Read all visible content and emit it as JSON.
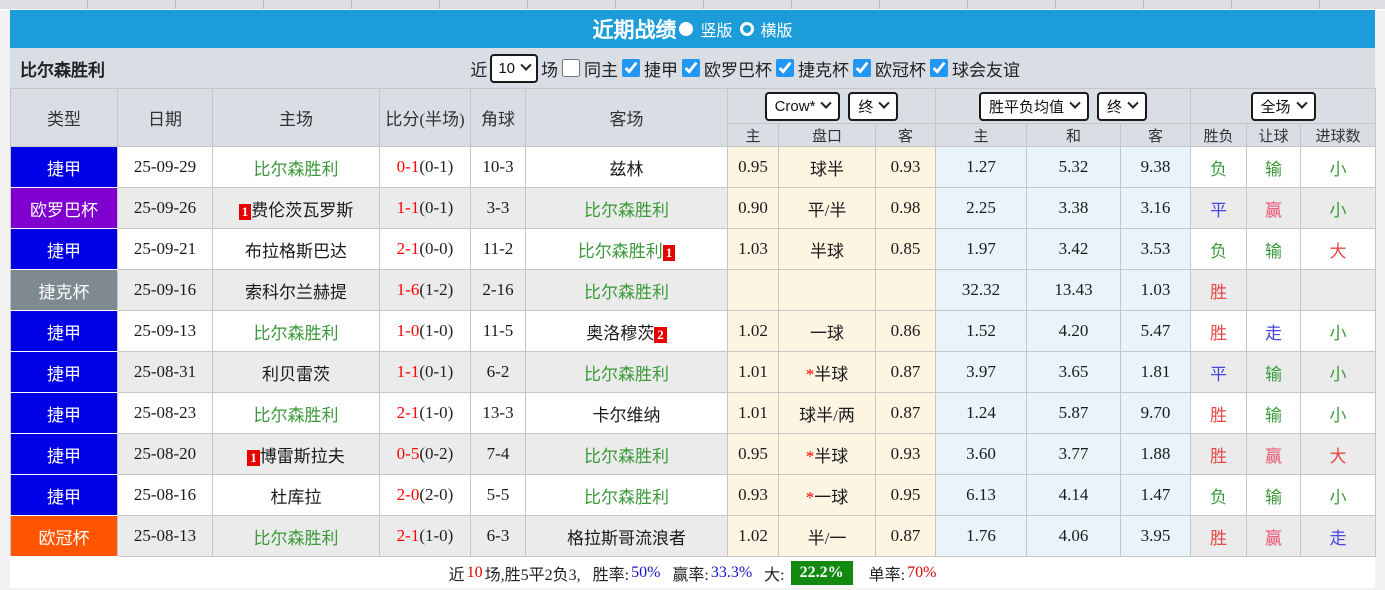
{
  "titlebar": {
    "title": "近期战绩",
    "vertical_label": "竖版",
    "horizontal_label": "横版"
  },
  "filters": {
    "team_name": "比尔森胜利",
    "recent_label": "近",
    "recent_count": "10",
    "matches_label": "场",
    "same_home_label": "同主",
    "league_checkboxes": [
      "捷甲",
      "欧罗巴杯",
      "捷克杯",
      "欧冠杯",
      "球会友谊"
    ]
  },
  "table": {
    "headers": {
      "type": "类型",
      "date": "日期",
      "home": "主场",
      "score": "比分(半场)",
      "corner": "角球",
      "away": "客场",
      "company_select": "Crow*",
      "company_time_select": "终",
      "avg_select": "胜平负均值",
      "avg_time_select": "终",
      "scope_select": "全场",
      "hcp_home": "主",
      "hcp_line": "盘口",
      "hcp_away": "客",
      "odds_home": "主",
      "odds_draw": "和",
      "odds_away": "客",
      "res_wdl": "胜负",
      "res_hcp": "让球",
      "res_goal": "进球数"
    },
    "rows": [
      {
        "type": "捷甲",
        "type_color": "#0000e6",
        "date": "25-09-29",
        "home": {
          "badge_before": "",
          "text": "比尔森胜利",
          "badge_after": "",
          "cls": "green"
        },
        "score_ft": "0-1",
        "score_ht": "(0-1)",
        "corner": "10-3",
        "away": {
          "badge_before": "",
          "text": "兹林",
          "badge_after": "",
          "cls": "plain"
        },
        "hcp": {
          "home": "0.95",
          "line_star": "",
          "line": "球半",
          "away": "0.93"
        },
        "odds": {
          "home": "1.27",
          "draw": "5.32",
          "away": "9.38"
        },
        "results": [
          {
            "text": "负",
            "cls": "green"
          },
          {
            "text": "输",
            "cls": "green"
          },
          {
            "text": "小",
            "cls": "green"
          }
        ]
      },
      {
        "type": "欧罗巴杯",
        "type_color": "#8000d0",
        "date": "25-09-26",
        "home": {
          "badge_before": "1",
          "text": "费伦茨瓦罗斯",
          "badge_after": "",
          "cls": "plain"
        },
        "score_ft": "1-1",
        "score_ht": "(0-1)",
        "corner": "3-3",
        "away": {
          "badge_before": "",
          "text": "比尔森胜利",
          "badge_after": "",
          "cls": "green"
        },
        "hcp": {
          "home": "0.90",
          "line_star": "",
          "line": "平/半",
          "away": "0.98"
        },
        "odds": {
          "home": "2.25",
          "draw": "3.38",
          "away": "3.16"
        },
        "results": [
          {
            "text": "平",
            "cls": "blue"
          },
          {
            "text": "赢",
            "cls": "pink"
          },
          {
            "text": "小",
            "cls": "green"
          }
        ]
      },
      {
        "type": "捷甲",
        "type_color": "#0000e6",
        "date": "25-09-21",
        "home": {
          "badge_before": "",
          "text": "布拉格斯巴达",
          "badge_after": "",
          "cls": "plain"
        },
        "score_ft": "2-1",
        "score_ht": "(0-0)",
        "corner": "11-2",
        "away": {
          "badge_before": "",
          "text": "比尔森胜利",
          "badge_after": "1",
          "cls": "green"
        },
        "hcp": {
          "home": "1.03",
          "line_star": "",
          "line": "半球",
          "away": "0.85"
        },
        "odds": {
          "home": "1.97",
          "draw": "3.42",
          "away": "3.53"
        },
        "results": [
          {
            "text": "负",
            "cls": "green"
          },
          {
            "text": "输",
            "cls": "green"
          },
          {
            "text": "大",
            "cls": "red"
          }
        ]
      },
      {
        "type": "捷克杯",
        "type_color": "#7e8a90",
        "date": "25-09-16",
        "home": {
          "badge_before": "",
          "text": "索科尔兰赫提",
          "badge_after": "",
          "cls": "plain"
        },
        "score_ft": "1-6",
        "score_ht": "(1-2)",
        "corner": "2-16",
        "away": {
          "badge_before": "",
          "text": "比尔森胜利",
          "badge_after": "",
          "cls": "green"
        },
        "hcp": {
          "home": "",
          "line_star": "",
          "line": "",
          "away": ""
        },
        "odds": {
          "home": "32.32",
          "draw": "13.43",
          "away": "1.03"
        },
        "results": [
          {
            "text": "胜",
            "cls": "red"
          },
          {
            "text": "",
            "cls": "plain"
          },
          {
            "text": "",
            "cls": "plain"
          }
        ]
      },
      {
        "type": "捷甲",
        "type_color": "#0000e6",
        "date": "25-09-13",
        "home": {
          "badge_before": "",
          "text": "比尔森胜利",
          "badge_after": "",
          "cls": "green"
        },
        "score_ft": "1-0",
        "score_ht": "(1-0)",
        "corner": "11-5",
        "away": {
          "badge_before": "",
          "text": "奥洛穆茨",
          "badge_after": "2",
          "cls": "plain"
        },
        "hcp": {
          "home": "1.02",
          "line_star": "",
          "line": "一球",
          "away": "0.86"
        },
        "odds": {
          "home": "1.52",
          "draw": "4.20",
          "away": "5.47"
        },
        "results": [
          {
            "text": "胜",
            "cls": "red"
          },
          {
            "text": "走",
            "cls": "blue"
          },
          {
            "text": "小",
            "cls": "green"
          }
        ]
      },
      {
        "type": "捷甲",
        "type_color": "#0000e6",
        "date": "25-08-31",
        "home": {
          "badge_before": "",
          "text": "利贝雷茨",
          "badge_after": "",
          "cls": "plain"
        },
        "score_ft": "1-1",
        "score_ht": "(0-1)",
        "corner": "6-2",
        "away": {
          "badge_before": "",
          "text": "比尔森胜利",
          "badge_after": "",
          "cls": "green"
        },
        "hcp": {
          "home": "1.01",
          "line_star": "*",
          "line": "半球",
          "away": "0.87"
        },
        "odds": {
          "home": "3.97",
          "draw": "3.65",
          "away": "1.81"
        },
        "results": [
          {
            "text": "平",
            "cls": "blue"
          },
          {
            "text": "输",
            "cls": "green"
          },
          {
            "text": "小",
            "cls": "green"
          }
        ]
      },
      {
        "type": "捷甲",
        "type_color": "#0000e6",
        "date": "25-08-23",
        "home": {
          "badge_before": "",
          "text": "比尔森胜利",
          "badge_after": "",
          "cls": "green"
        },
        "score_ft": "2-1",
        "score_ht": "(1-0)",
        "corner": "13-3",
        "away": {
          "badge_before": "",
          "text": "卡尔维纳",
          "badge_after": "",
          "cls": "plain"
        },
        "hcp": {
          "home": "1.01",
          "line_star": "",
          "line": "球半/两",
          "away": "0.87"
        },
        "odds": {
          "home": "1.24",
          "draw": "5.87",
          "away": "9.70"
        },
        "results": [
          {
            "text": "胜",
            "cls": "red"
          },
          {
            "text": "输",
            "cls": "green"
          },
          {
            "text": "小",
            "cls": "green"
          }
        ]
      },
      {
        "type": "捷甲",
        "type_color": "#0000e6",
        "date": "25-08-20",
        "home": {
          "badge_before": "1",
          "text": "博雷斯拉夫",
          "badge_after": "",
          "cls": "plain"
        },
        "score_ft": "0-5",
        "score_ht": "(0-2)",
        "corner": "7-4",
        "away": {
          "badge_before": "",
          "text": "比尔森胜利",
          "badge_after": "",
          "cls": "green"
        },
        "hcp": {
          "home": "0.95",
          "line_star": "*",
          "line": "半球",
          "away": "0.93"
        },
        "odds": {
          "home": "3.60",
          "draw": "3.77",
          "away": "1.88"
        },
        "results": [
          {
            "text": "胜",
            "cls": "red"
          },
          {
            "text": "赢",
            "cls": "pink"
          },
          {
            "text": "大",
            "cls": "red"
          }
        ]
      },
      {
        "type": "捷甲",
        "type_color": "#0000e6",
        "date": "25-08-16",
        "home": {
          "badge_before": "",
          "text": "杜库拉",
          "badge_after": "",
          "cls": "plain"
        },
        "score_ft": "2-0",
        "score_ht": "(2-0)",
        "corner": "5-5",
        "away": {
          "badge_before": "",
          "text": "比尔森胜利",
          "badge_after": "",
          "cls": "green"
        },
        "hcp": {
          "home": "0.93",
          "line_star": "*",
          "line": "一球",
          "away": "0.95"
        },
        "odds": {
          "home": "6.13",
          "draw": "4.14",
          "away": "1.47"
        },
        "results": [
          {
            "text": "负",
            "cls": "green"
          },
          {
            "text": "输",
            "cls": "green"
          },
          {
            "text": "小",
            "cls": "green"
          }
        ]
      },
      {
        "type": "欧冠杯",
        "type_color": "#ff5400",
        "date": "25-08-13",
        "home": {
          "badge_before": "",
          "text": "比尔森胜利",
          "badge_after": "",
          "cls": "green"
        },
        "score_ft": "2-1",
        "score_ht": "(1-0)",
        "corner": "6-3",
        "away": {
          "badge_before": "",
          "text": "格拉斯哥流浪者",
          "badge_after": "",
          "cls": "plain"
        },
        "hcp": {
          "home": "1.02",
          "line_star": "",
          "line": "半/一",
          "away": "0.87"
        },
        "odds": {
          "home": "1.76",
          "draw": "4.06",
          "away": "3.95"
        },
        "results": [
          {
            "text": "胜",
            "cls": "red"
          },
          {
            "text": "赢",
            "cls": "pink"
          },
          {
            "text": "走",
            "cls": "blue"
          }
        ]
      }
    ]
  },
  "summary": {
    "prefix": "近",
    "count": "10",
    "mid": "场,胜5平2负3,",
    "win_rate_label": "胜率:",
    "win_rate": "50%",
    "hcp_rate_label": "赢率:",
    "hcp_rate": "33.3%",
    "big_label": "大:",
    "big_rate": "22.2%",
    "single_label": "单率:",
    "single_rate": "70%"
  },
  "colors": {
    "titlebar_blue": "#1c9cd8",
    "league_jiejia": "#0000e6",
    "league_europa": "#8000d0",
    "league_czech_cup": "#7e8a90",
    "league_champions": "#ff5400",
    "team_green": "#3a9a3a",
    "score_red": "#ff0000",
    "summary_green_box": "#128a12"
  }
}
